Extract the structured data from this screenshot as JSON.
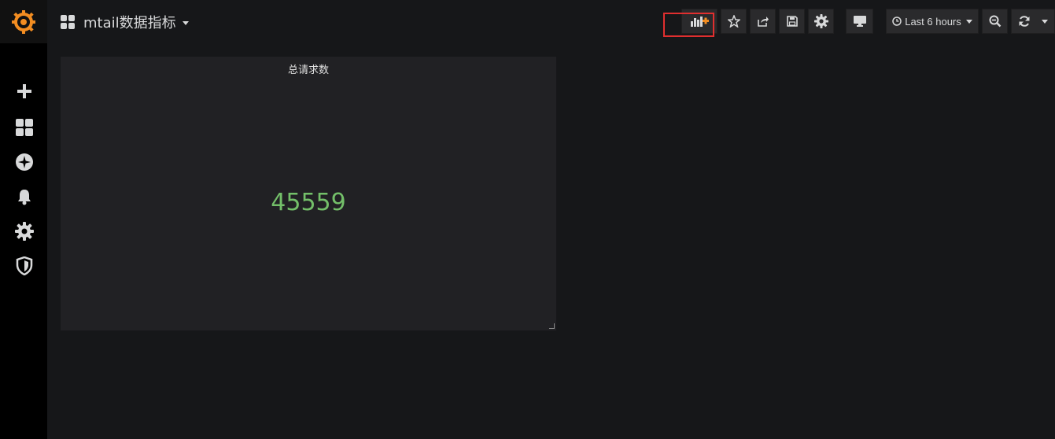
{
  "dashboard": {
    "title": "mtail数据指标"
  },
  "toolbar": {
    "time_range_label": "Last 6 hours",
    "buttons": [
      "add-panel",
      "star",
      "share",
      "save",
      "settings",
      "tv-mode",
      "time-range",
      "zoom-out",
      "refresh"
    ]
  },
  "panel": {
    "title": "总请求数",
    "value": "45559",
    "value_color": "#73bf69"
  },
  "colors": {
    "background": "#161719",
    "sidebar": "#000000",
    "panel": "#212124",
    "accent": "#f38d21",
    "highlight": "#e02f2f"
  },
  "sidebar": {
    "items": [
      "create-icon",
      "dashboards-icon",
      "explore-icon",
      "alerting-icon",
      "configuration-icon",
      "server-admin-icon"
    ]
  }
}
